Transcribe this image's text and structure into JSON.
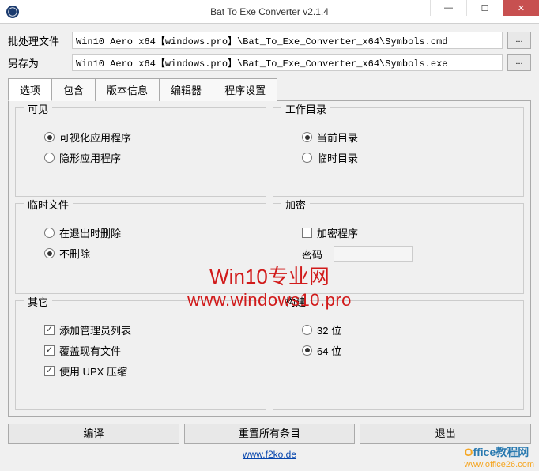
{
  "window": {
    "title": "Bat To Exe Converter v2.1.4"
  },
  "files": {
    "batch_label": "批处理文件",
    "batch_value": "Win10 Aero x64【windows.pro】\\Bat_To_Exe_Converter_x64\\Symbols.cmd",
    "saveas_label": "另存为",
    "saveas_value": "Win10 Aero x64【windows.pro】\\Bat_To_Exe_Converter_x64\\Symbols.exe",
    "browse": "..."
  },
  "tabs": [
    "选项",
    "包含",
    "版本信息",
    "编辑器",
    "程序设置"
  ],
  "groups": {
    "visible": {
      "legend": "可见",
      "opt_visual": "可视化应用程序",
      "opt_invisible": "隐形应用程序"
    },
    "workdir": {
      "legend": "工作目录",
      "opt_current": "当前目录",
      "opt_temp": "临时目录"
    },
    "tempfiles": {
      "legend": "临时文件",
      "opt_delete": "在退出时删除",
      "opt_nodelete": "不删除"
    },
    "encrypt": {
      "legend": "加密",
      "chk_encrypt": "加密程序",
      "pw_label": "密码"
    },
    "other": {
      "legend": "其它",
      "chk_admin": "添加管理员列表",
      "chk_overwrite": "覆盖现有文件",
      "chk_upx": "使用 UPX 压缩"
    },
    "build": {
      "legend": "构建",
      "opt_32": "32 位",
      "opt_64": "64 位"
    }
  },
  "buttons": {
    "compile": "编译",
    "reset": "重置所有条目",
    "exit": "退出"
  },
  "footer_link": "www.f2ko.de",
  "watermark": {
    "line1": "Win10专业网",
    "line2": "www.windows10.pro"
  },
  "brand": {
    "text_prefix": "O",
    "text_rest": "ffice教程网",
    "url": "www.office26.com"
  }
}
